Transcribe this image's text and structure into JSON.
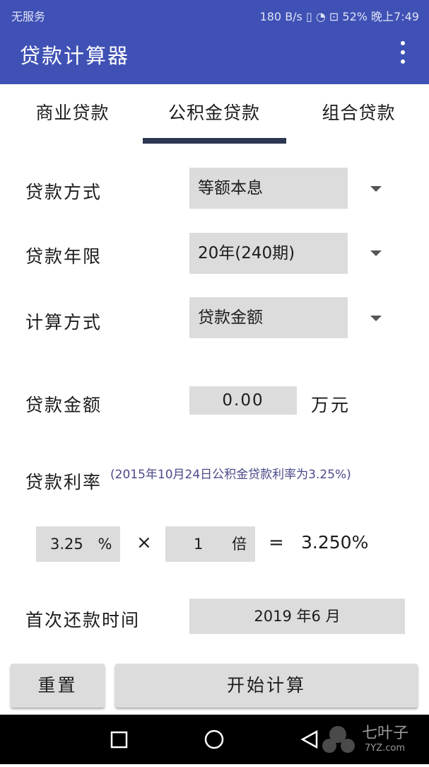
{
  "status_bar": {
    "carrier": "无服务",
    "right": "180 B/s ▯ ◔ ⊡ 52%  晚上7:49"
  },
  "app": {
    "title": "贷款计算器"
  },
  "tabs": [
    {
      "label": "商业贷款"
    },
    {
      "label": "公积金贷款"
    },
    {
      "label": "组合贷款"
    }
  ],
  "form": {
    "loan_method": {
      "label": "贷款方式",
      "value": "等额本息"
    },
    "loan_term": {
      "label": "贷款年限",
      "value": "20年(240期)"
    },
    "calc_method": {
      "label": "计算方式",
      "value": "贷款金额"
    },
    "loan_amount": {
      "label": "贷款金额",
      "value": "0.00",
      "unit": "万元"
    },
    "interest": {
      "label": "贷款利率",
      "note": "(2015年10月24日公积金贷款利率为3.25%)",
      "rate": "3.25",
      "rate_unit": "%",
      "times_sign": "×",
      "multiplier": "1",
      "multiplier_unit": "倍",
      "equals_sign": "=",
      "result": "3.250%"
    },
    "first_payment": {
      "label": "首次还款时间",
      "value": "2019 年6 月"
    }
  },
  "buttons": {
    "reset": "重置",
    "calculate": "开始计算"
  },
  "watermark": {
    "name": "七叶子",
    "domain": "7YZ.com"
  },
  "colors": {
    "app_bar": "#3f51b5",
    "field_bg": "#dcdcdc",
    "tab_indicator": "#2c3652"
  }
}
